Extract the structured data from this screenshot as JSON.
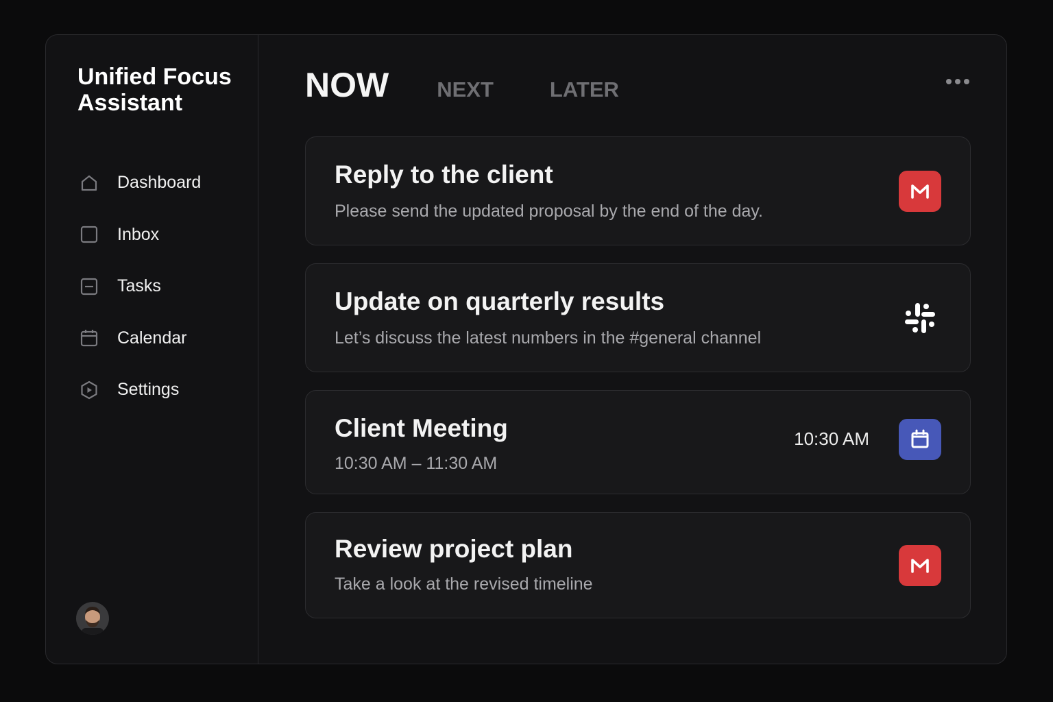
{
  "app": {
    "title": "Unified Focus Assistant"
  },
  "sidebar": {
    "items": [
      {
        "label": "Dashboard",
        "icon": "home-icon"
      },
      {
        "label": "Inbox",
        "icon": "inbox-icon"
      },
      {
        "label": "Tasks",
        "icon": "tasks-icon"
      },
      {
        "label": "Calendar",
        "icon": "calendar-icon"
      },
      {
        "label": "Settings",
        "icon": "settings-icon"
      }
    ]
  },
  "header": {
    "tabs": [
      {
        "label": "NOW",
        "active": true
      },
      {
        "label": "NEXT",
        "active": false
      },
      {
        "label": "LATER",
        "active": false
      }
    ],
    "more_icon": "more-icon"
  },
  "cards": [
    {
      "title": "Reply to the client",
      "subtitle": "Please send the updated proposal by the end of the day.",
      "source_icon": "gmail-icon",
      "badge_color": "#d8393b"
    },
    {
      "title": "Update on quarterly results",
      "subtitle": "Let’s discuss the latest numbers in the #general channel",
      "source_icon": "slack-icon"
    },
    {
      "title": "Client Meeting",
      "subtitle": "10:30 AM – 11:30 AM",
      "time": "10:30 AM",
      "source_icon": "calendar-icon",
      "badge_color": "#4758b8"
    },
    {
      "title": "Review project plan",
      "subtitle": "Take a look at the revised timeline",
      "source_icon": "gmail-icon",
      "badge_color": "#d8393b"
    }
  ],
  "colors": {
    "background": "#0b0b0c",
    "panel": "#121214",
    "card": "#18181a",
    "gmail_red": "#d8393b",
    "calendar_blue": "#4758b8"
  }
}
